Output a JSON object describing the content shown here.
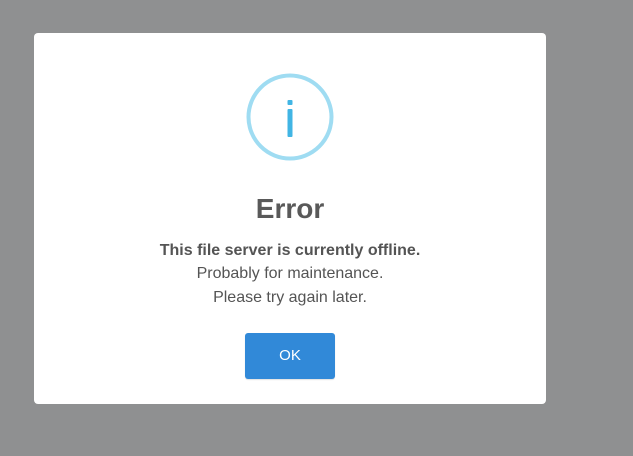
{
  "dialog": {
    "icon": "info-icon",
    "title": "Error",
    "message_lines": [
      "This file server is currently offline.",
      "Probably for maintenance.",
      "Please try again later."
    ],
    "ok_label": "OK"
  },
  "colors": {
    "backdrop": "#8f9091",
    "dialog_background": "#ffffff",
    "icon_ring": "#9fdcf2",
    "icon_glyph": "#41b5e4",
    "title_text": "#595959",
    "body_text": "#545454",
    "button_background": "#3189d8",
    "button_text": "#ffffff"
  }
}
